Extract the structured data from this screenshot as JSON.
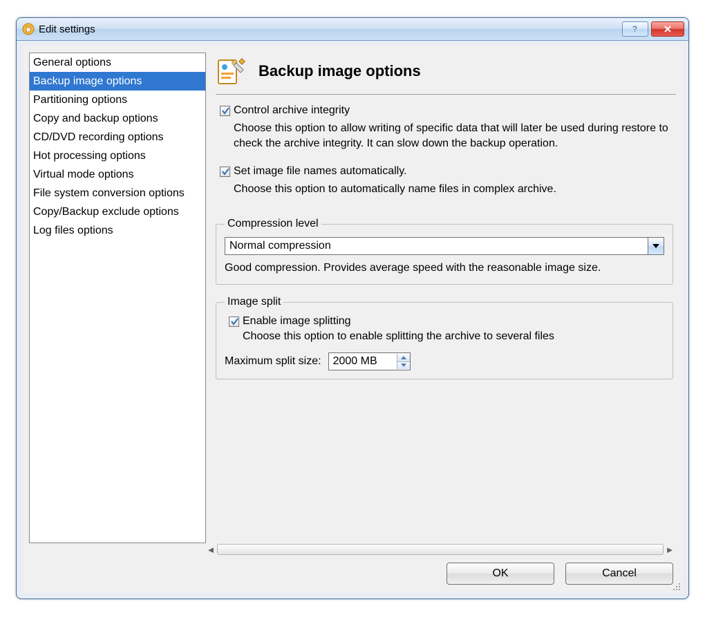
{
  "window": {
    "title": "Edit settings"
  },
  "sidebar": {
    "items": [
      {
        "label": "General options",
        "selected": false
      },
      {
        "label": "Backup image options",
        "selected": true
      },
      {
        "label": "Partitioning options",
        "selected": false
      },
      {
        "label": "Copy and backup options",
        "selected": false
      },
      {
        "label": "CD/DVD recording options",
        "selected": false
      },
      {
        "label": "Hot processing options",
        "selected": false
      },
      {
        "label": "Virtual mode options",
        "selected": false
      },
      {
        "label": "File system conversion options",
        "selected": false
      },
      {
        "label": "Copy/Backup exclude options",
        "selected": false
      },
      {
        "label": "Log files options",
        "selected": false
      }
    ]
  },
  "main": {
    "title": "Backup image options",
    "control_archive": {
      "label": "Control archive integrity",
      "checked": true,
      "desc": "Choose this option to allow writing of specific data that will later be used during restore to check the archive integrity. It can slow down the backup operation."
    },
    "auto_names": {
      "label": "Set image file names automatically.",
      "checked": true,
      "desc": "Choose this option to automatically name files in complex archive."
    },
    "compression": {
      "legend": "Compression level",
      "value": "Normal compression",
      "desc": "Good compression. Provides average speed with the reasonable image size."
    },
    "split": {
      "legend": "Image split",
      "enable_label": "Enable image splitting",
      "enable_checked": true,
      "enable_desc": "Choose this option to enable splitting the archive to several files",
      "max_label": "Maximum split size:",
      "max_value": "2000 MB"
    }
  },
  "buttons": {
    "ok": "OK",
    "cancel": "Cancel"
  }
}
